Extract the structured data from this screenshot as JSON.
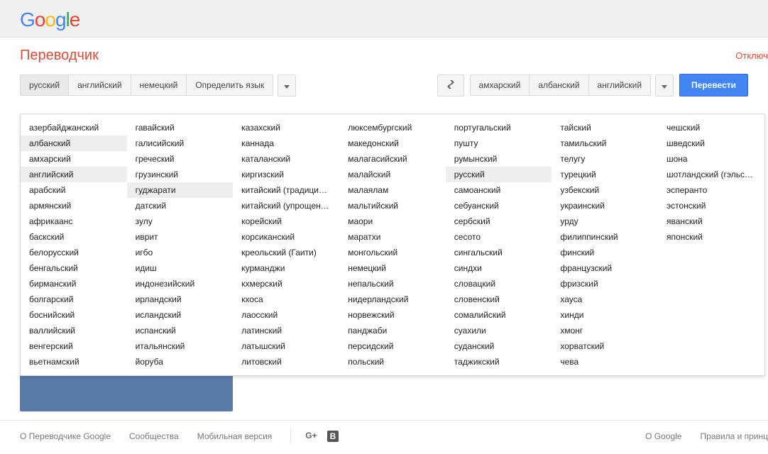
{
  "logo_letters": [
    "G",
    "o",
    "o",
    "g",
    "l",
    "e"
  ],
  "app_title": "Переводчик",
  "off_link": "Отключ",
  "source_tabs": [
    "русский",
    "английский",
    "немецкий",
    "Определить язык"
  ],
  "source_selected": 0,
  "target_tabs": [
    "амхарский",
    "албанский",
    "английский"
  ],
  "translate_btn": "Перевести",
  "lang_columns": [
    [
      "азербайджанский",
      "албанский",
      "амхарский",
      "английский",
      "арабский",
      "армянский",
      "африкаанс",
      "баскский",
      "белорусский",
      "бенгальский",
      "бирманский",
      "болгарский",
      "боснийский",
      "валлийский",
      "венгерский",
      "вьетнамский"
    ],
    [
      "гавайский",
      "галисийский",
      "греческий",
      "грузинский",
      "гуджарати",
      "датский",
      "зулу",
      "иврит",
      "игбо",
      "идиш",
      "индонезийский",
      "ирландский",
      "исландский",
      "испанский",
      "итальянский",
      "йоруба"
    ],
    [
      "казахский",
      "каннада",
      "каталанский",
      "киргизский",
      "китайский (традиционный)",
      "китайский (упрощенный)",
      "корейский",
      "корсиканский",
      "креольский (Гаити)",
      "курманджи",
      "кхмерский",
      "кхоса",
      "лаосский",
      "латинский",
      "латышский",
      "литовский"
    ],
    [
      "люксембургский",
      "македонский",
      "малагасийский",
      "малайский",
      "малаялам",
      "мальтийский",
      "маори",
      "маратхи",
      "монгольский",
      "немецкий",
      "непальский",
      "нидерландский",
      "норвежский",
      "панджаби",
      "персидский",
      "польский"
    ],
    [
      "португальский",
      "пушту",
      "румынский",
      "русский",
      "самоанский",
      "себуанский",
      "сербский",
      "сесото",
      "сингальский",
      "синдхи",
      "словацкий",
      "словенский",
      "сомалийский",
      "суахили",
      "суданский",
      "таджикский"
    ],
    [
      "тайский",
      "тамильский",
      "телугу",
      "турецкий",
      "узбекский",
      "украинский",
      "урду",
      "филиппинский",
      "финский",
      "французский",
      "фризский",
      "хауса",
      "хинди",
      "хмонг",
      "хорватский",
      "чева"
    ],
    [
      "чешский",
      "шведский",
      "шона",
      "шотландский (гэльский)",
      "эсперанто",
      "эстонский",
      "яванский",
      "японский"
    ]
  ],
  "lang_highlighted": [
    "албанский",
    "английский",
    "гуджарати",
    "русский"
  ],
  "footer": {
    "about": "О Переводчике Google",
    "community": "Сообщества",
    "mobile": "Мобильная версия",
    "about_google": "О Google",
    "rules": "Правила и принц"
  }
}
